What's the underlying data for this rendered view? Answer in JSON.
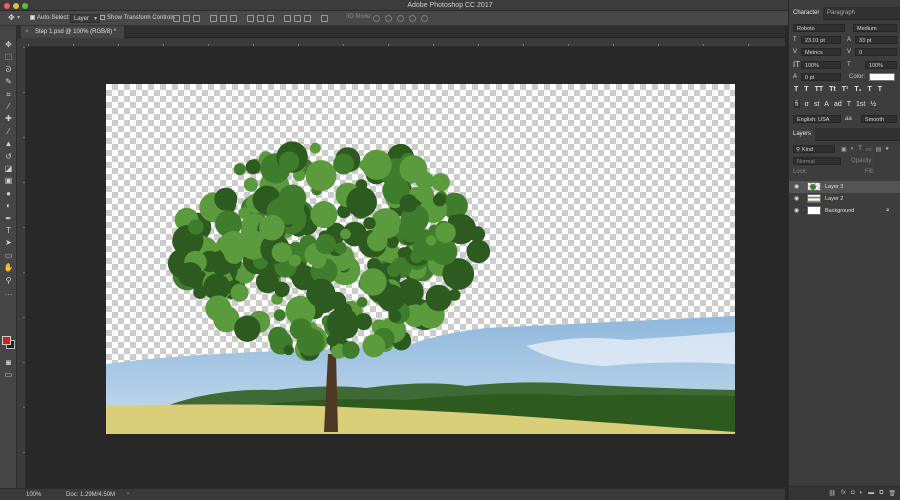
{
  "window": {
    "title": "Adobe Photoshop CC 2017",
    "traffic_colors": [
      "#fc5b57",
      "#e5bf3c",
      "#57c038"
    ]
  },
  "options_bar": {
    "move_icon": "move-icon",
    "auto_select_label": "Auto-Select:",
    "auto_select_checked": true,
    "auto_select_target": "Layer",
    "show_transform_label": "Show Transform Controls",
    "show_transform_checked": false,
    "mode_3d_label": "3D Mode:"
  },
  "document": {
    "tab_title": "Step 1.psd @ 100% (RGB/8) *",
    "zoom": "100%",
    "doc_info": "Doc: 1.29M/4.50M"
  },
  "tools": [
    {
      "name": "move-tool",
      "glyph": "✥"
    },
    {
      "name": "marquee-tool",
      "glyph": "⬚"
    },
    {
      "name": "lasso-tool",
      "glyph": "ᘐ"
    },
    {
      "name": "quick-select-tool",
      "glyph": "✎"
    },
    {
      "name": "crop-tool",
      "glyph": "⌗"
    },
    {
      "name": "eyedropper-tool",
      "glyph": "⁄"
    },
    {
      "name": "healing-brush-tool",
      "glyph": "✚"
    },
    {
      "name": "brush-tool",
      "glyph": "⁄"
    },
    {
      "name": "clone-stamp-tool",
      "glyph": "▲"
    },
    {
      "name": "history-brush-tool",
      "glyph": "↺"
    },
    {
      "name": "eraser-tool",
      "glyph": "◪"
    },
    {
      "name": "gradient-tool",
      "glyph": "▣"
    },
    {
      "name": "blur-tool",
      "glyph": "●"
    },
    {
      "name": "dodge-tool",
      "glyph": "◐"
    },
    {
      "name": "pen-tool",
      "glyph": "✒"
    },
    {
      "name": "type-tool",
      "glyph": "T"
    },
    {
      "name": "path-select-tool",
      "glyph": "➤"
    },
    {
      "name": "shape-tool",
      "glyph": "▭"
    },
    {
      "name": "hand-tool",
      "glyph": "✋"
    },
    {
      "name": "zoom-tool",
      "glyph": "⚲"
    },
    {
      "name": "edit-toolbar",
      "glyph": "…"
    }
  ],
  "character_panel": {
    "tab_character": "Character",
    "tab_paragraph": "Paragraph",
    "font_family": "Roboto",
    "font_style": "Medium",
    "font_size": "23.01 pt",
    "leading": "33 pt",
    "kerning": "Metrics",
    "tracking": "0",
    "vertical_scale": "100%",
    "horizontal_scale": "100%",
    "baseline_shift": "0 pt",
    "color_label": "Color:",
    "text_color": "#ffffff",
    "type_buttons_row1": [
      "T",
      "T",
      "TT",
      "Tt",
      "T¹",
      "T₁",
      "T",
      "T"
    ],
    "type_buttons_row2": [
      "fi",
      "σ",
      "st",
      "A",
      "ad",
      "T",
      "1st",
      "½"
    ],
    "language": "English: USA",
    "aa_label": "aa",
    "antialias": "Smooth"
  },
  "layers_panel": {
    "tab_layers": "Layers",
    "filter_kind": "Kind",
    "blend_mode": "Normal",
    "opacity_label": "Opacity:",
    "fill_label": "Fill:",
    "lock_label": "Lock:",
    "layers": [
      {
        "name": "Layer 3",
        "visible": true,
        "thumb": "tree",
        "selected": true
      },
      {
        "name": "Layer 2",
        "visible": true,
        "thumb": "landscape",
        "selected": false
      },
      {
        "name": "Background",
        "visible": true,
        "thumb": "white",
        "selected": false,
        "locked": true
      }
    ],
    "bottom_icons": [
      "link-icon",
      "fx-icon",
      "mask-icon",
      "adjustment-icon",
      "folder-icon",
      "new-layer-icon",
      "trash-icon"
    ]
  },
  "colors": {
    "foreground": "#d11e1e",
    "background": "#222222",
    "sky_top": "#8fb8dc",
    "sky_bottom": "#c8dcee",
    "hills": "#3f6a35",
    "field": "#d9cf7a",
    "tree_dark": "#2c5a1f",
    "tree_mid": "#3f7d2c",
    "tree_light": "#5c9a3e",
    "trunk": "#4e3a24"
  }
}
